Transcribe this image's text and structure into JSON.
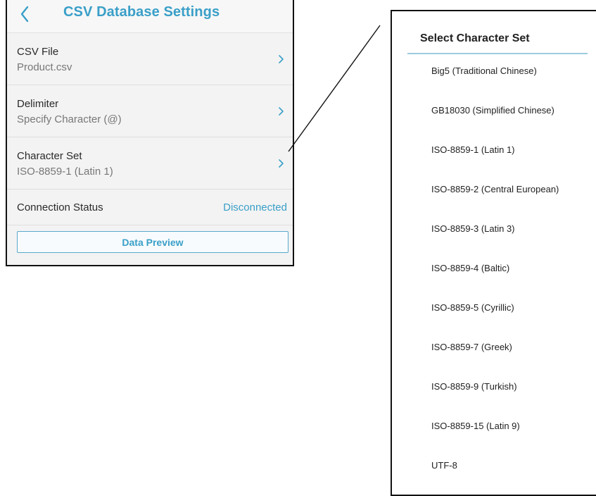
{
  "header": {
    "title": "CSV Database Settings"
  },
  "settings": [
    {
      "label": "CSV File",
      "value": "Product.csv"
    },
    {
      "label": "Delimiter",
      "value": "Specify Character (@)"
    },
    {
      "label": "Character Set",
      "value": "ISO-8859-1 (Latin 1)"
    }
  ],
  "connection": {
    "label": "Connection Status",
    "status": "Disconnected"
  },
  "preview_button": "Data Preview",
  "picker": {
    "title": "Select Character Set",
    "options": [
      "Big5 (Traditional Chinese)",
      "GB18030 (Simplified Chinese)",
      "ISO-8859-1 (Latin 1)",
      "ISO-8859-2 (Central European)",
      "ISO-8859-3 (Latin 3)",
      "ISO-8859-4 (Baltic)",
      "ISO-8859-5 (Cyrillic)",
      "ISO-8859-7 (Greek)",
      "ISO-8859-9 (Turkish)",
      "ISO-8859-15 (Latin 9)",
      "UTF-8"
    ]
  },
  "colors": {
    "accent": "#3a9fc8",
    "panel_bg": "#f3f3f3",
    "divider": "#dedede"
  }
}
